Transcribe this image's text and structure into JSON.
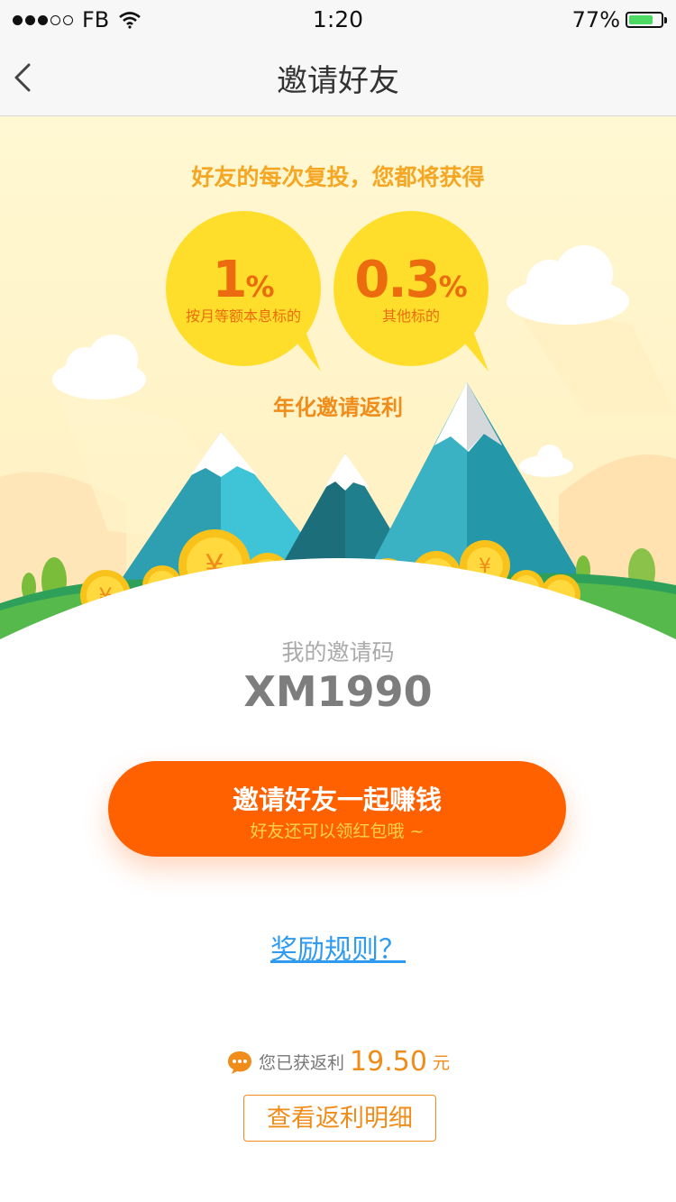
{
  "status_bar": {
    "carrier": "FB",
    "time": "1:20",
    "battery": "77%",
    "battery_level": 0.77
  },
  "nav": {
    "title": "邀请好友",
    "back_icon": "chevron-left-icon"
  },
  "hero": {
    "headline": "好友的每次复投，您都将获得",
    "bubbles": [
      {
        "value": "1",
        "unit": "%",
        "label": "按月等额本息标的"
      },
      {
        "value": "0.3",
        "unit": "%",
        "label": "其他标的"
      }
    ],
    "subheadline": "年化邀请返利"
  },
  "invite": {
    "label": "我的邀请码",
    "code": "XM1990"
  },
  "cta": {
    "title": "邀请好友一起赚钱",
    "subtitle": "好友还可以领红包哦 ~"
  },
  "rules": {
    "link": "奖励规则？"
  },
  "earnings": {
    "prefix": "您已获返利",
    "amount": "19.50",
    "unit": "元",
    "icon": "chat-bubble-icon"
  },
  "detail_button": {
    "label": "查看返利明细"
  },
  "colors": {
    "accent": "#ff6100",
    "gold": "#f08c1a",
    "link": "#2f9bf0"
  }
}
